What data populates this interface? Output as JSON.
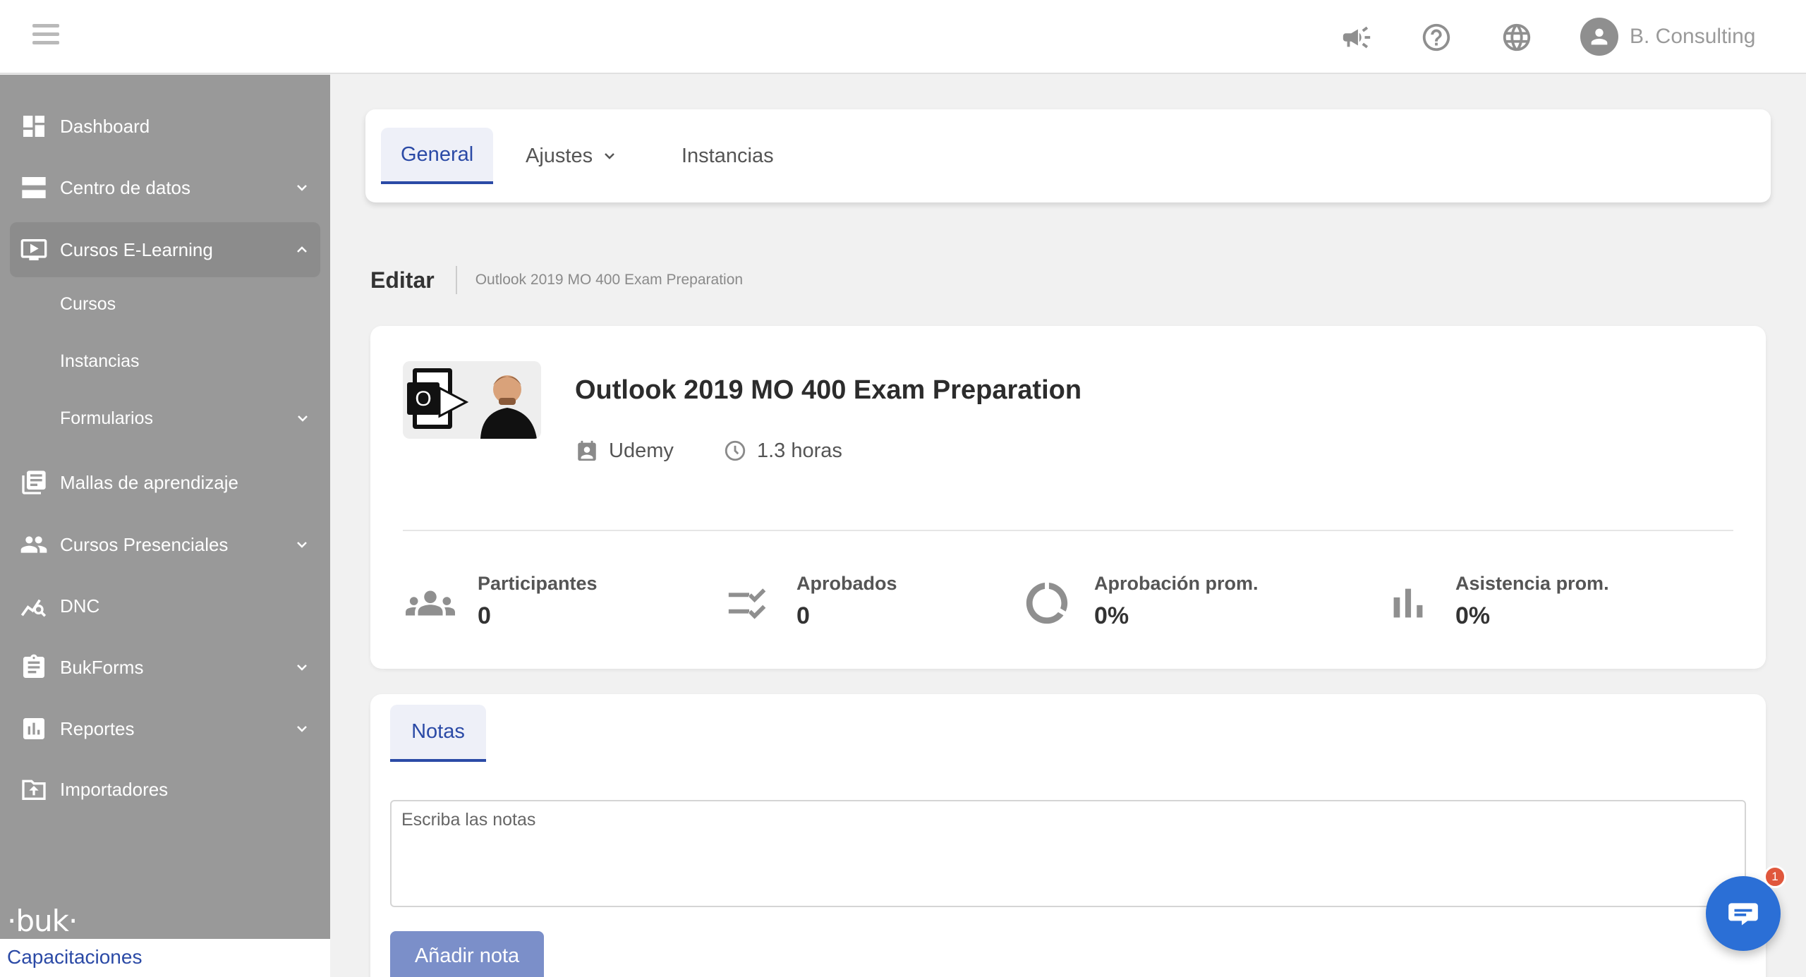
{
  "header": {
    "user_name": "B. Consulting",
    "icons": [
      "menu-icon",
      "megaphone-icon",
      "help-icon",
      "globe-icon",
      "user-avatar-icon"
    ]
  },
  "sidebar": {
    "items": [
      {
        "label": "Dashboard",
        "icon": "dashboard-icon"
      },
      {
        "label": "Centro de datos",
        "icon": "server-icon"
      },
      {
        "label": "Cursos E-Learning",
        "icon": "monitor-play-icon"
      },
      {
        "label": "Mallas de aprendizaje",
        "icon": "library-icon"
      },
      {
        "label": "Cursos Presenciales",
        "icon": "people-icon"
      },
      {
        "label": "DNC",
        "icon": "trend-search-icon"
      },
      {
        "label": "BukForms",
        "icon": "clipboard-icon"
      },
      {
        "label": "Reportes",
        "icon": "report-chart-icon"
      },
      {
        "label": "Importadores",
        "icon": "upload-folder-icon"
      }
    ],
    "subitems": [
      "Cursos",
      "Instancias",
      "Formularios"
    ],
    "brand_logo": "·buk·",
    "brand_footer": "Capacitaciones"
  },
  "tabs": {
    "general": "General",
    "ajustes": "Ajustes",
    "instancias": "Instancias"
  },
  "page": {
    "title": "Editar",
    "crumb": "Outlook 2019 MO 400 Exam Preparation"
  },
  "course": {
    "title": "Outlook 2019 MO 400 Exam Preparation",
    "provider": "Udemy",
    "duration": "1.3 horas",
    "stats": [
      {
        "label": "Participantes",
        "value": "0"
      },
      {
        "label": "Aprobados",
        "value": "0"
      },
      {
        "label": "Aprobación prom.",
        "value": "0%"
      },
      {
        "label": "Asistencia prom.",
        "value": "0%"
      }
    ]
  },
  "notes": {
    "tab_label": "Notas",
    "placeholder": "Escriba las notas",
    "button_label": "Añadir nota"
  },
  "chat": {
    "badge_count": "1"
  },
  "colors": {
    "accent": "#2b4aa6",
    "sidebar_bg": "#999999",
    "button_bg": "#7b8fc9",
    "chat_bg": "#2b6fd6"
  }
}
